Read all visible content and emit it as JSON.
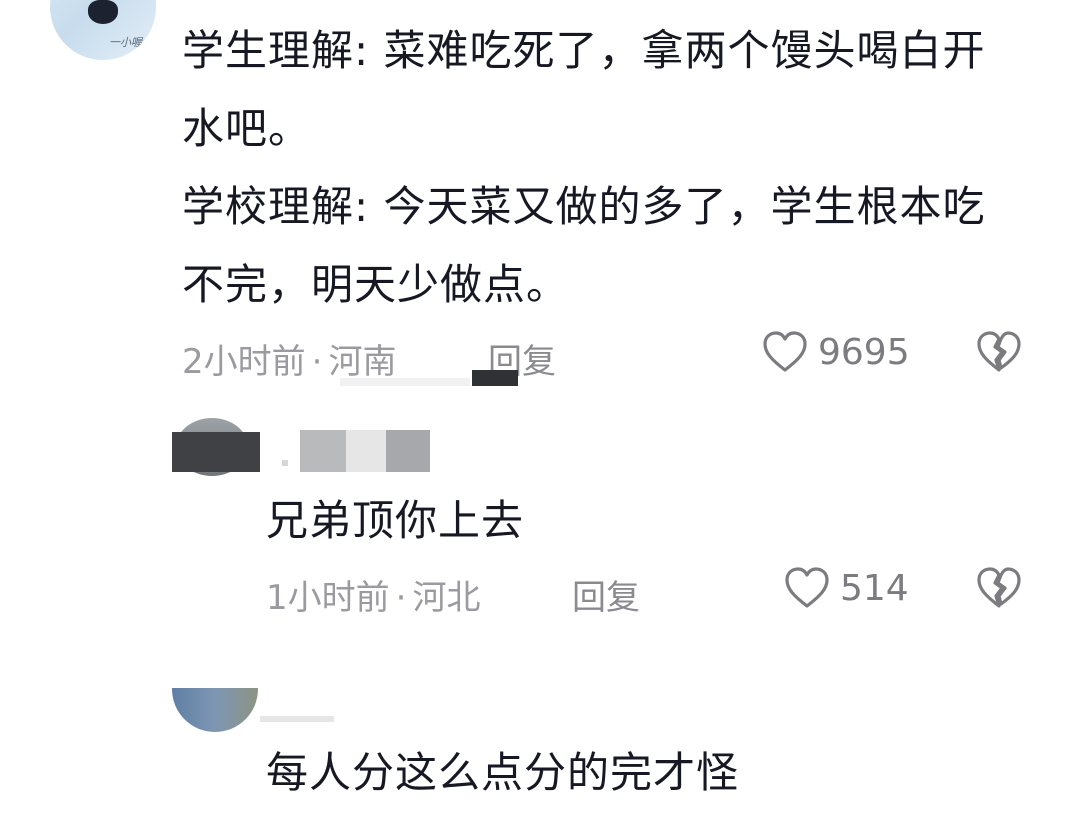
{
  "comments": [
    {
      "lines": [
        "学生理解: 菜难吃死了，拿两个馒头喝白开",
        "水吧。",
        "学校理解: 今天菜又做的多了，学生根本吃",
        "不完，明天少做点。"
      ],
      "time": "2小时前",
      "separator": "·",
      "location": "河南",
      "reply": "回复",
      "likes": "9695",
      "avatar_text": "一小喔"
    },
    {
      "lines": [
        "兄弟顶你上去"
      ],
      "time": "1小时前",
      "separator": "·",
      "location": "河北",
      "reply": "回复",
      "likes": "514"
    },
    {
      "lines": [
        "每人分这么点分的完才怪"
      ]
    }
  ],
  "icons": {
    "like": "heart-outline-icon",
    "dislike": "broken-heart-icon"
  },
  "colors": {
    "text": "#161823",
    "meta": "#9a9aa0",
    "icon": "#7b7b80"
  }
}
